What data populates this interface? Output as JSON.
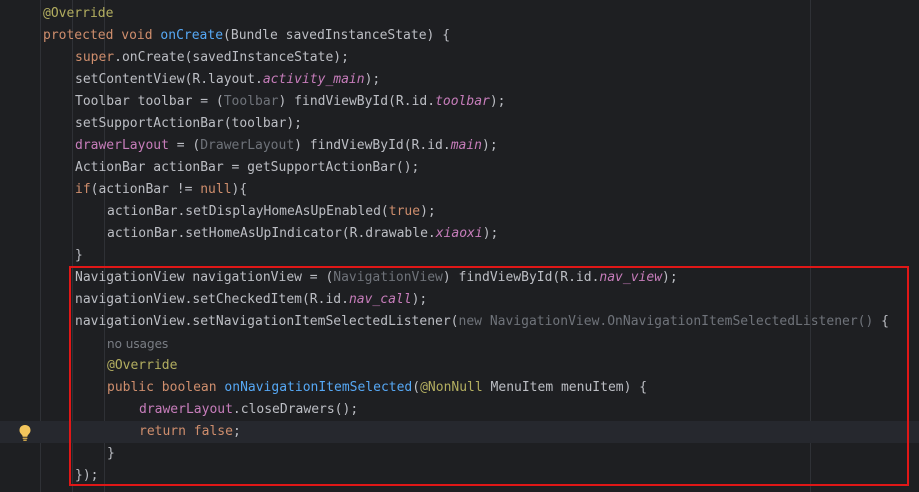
{
  "editor": {
    "lines": [
      {
        "indent": 0,
        "current": false,
        "tokens": [
          {
            "t": "@Override",
            "c": "ann"
          }
        ]
      },
      {
        "indent": 0,
        "current": false,
        "tokens": [
          {
            "t": "protected ",
            "c": "kw"
          },
          {
            "t": "void ",
            "c": "kw"
          },
          {
            "t": "onCreate",
            "c": "fn"
          },
          {
            "t": "(Bundle savedInstanceState) {",
            "c": ""
          }
        ]
      },
      {
        "indent": 1,
        "current": false,
        "tokens": [
          {
            "t": "super",
            "c": "kw"
          },
          {
            "t": ".onCreate(savedInstanceState);",
            "c": ""
          }
        ]
      },
      {
        "indent": 1,
        "current": false,
        "tokens": [
          {
            "t": "setContentView(R.layout.",
            "c": ""
          },
          {
            "t": "activity_main",
            "c": "fld"
          },
          {
            "t": ");",
            "c": ""
          }
        ]
      },
      {
        "indent": 1,
        "current": false,
        "tokens": [
          {
            "t": "Toolbar toolbar = (",
            "c": ""
          },
          {
            "t": "Toolbar",
            "c": "cast"
          },
          {
            "t": ") findViewById(R.id.",
            "c": ""
          },
          {
            "t": "toolbar",
            "c": "fld"
          },
          {
            "t": ");",
            "c": ""
          }
        ]
      },
      {
        "indent": 1,
        "current": false,
        "tokens": [
          {
            "t": "setSupportActionBar(toolbar);",
            "c": ""
          }
        ]
      },
      {
        "indent": 1,
        "current": false,
        "tokens": [
          {
            "t": "drawerLayout",
            "c": "fld-ni"
          },
          {
            "t": " = (",
            "c": ""
          },
          {
            "t": "DrawerLayout",
            "c": "cast"
          },
          {
            "t": ") findViewById(R.id.",
            "c": ""
          },
          {
            "t": "main",
            "c": "fld"
          },
          {
            "t": ");",
            "c": ""
          }
        ]
      },
      {
        "indent": 1,
        "current": false,
        "tokens": [
          {
            "t": "ActionBar actionBar = getSupportActionBar();",
            "c": ""
          }
        ]
      },
      {
        "indent": 1,
        "current": false,
        "tokens": [
          {
            "t": "if",
            "c": "kw"
          },
          {
            "t": "(actionBar != ",
            "c": ""
          },
          {
            "t": "null",
            "c": "kw"
          },
          {
            "t": "){",
            "c": ""
          }
        ]
      },
      {
        "indent": 2,
        "current": false,
        "tokens": [
          {
            "t": "actionBar.setDisplayHomeAsUpEnabled(",
            "c": ""
          },
          {
            "t": "true",
            "c": "kw"
          },
          {
            "t": ");",
            "c": ""
          }
        ]
      },
      {
        "indent": 2,
        "current": false,
        "tokens": [
          {
            "t": "actionBar.setHomeAsUpIndicator(R.drawable.",
            "c": ""
          },
          {
            "t": "xiaoxi",
            "c": "fld"
          },
          {
            "t": ");",
            "c": ""
          }
        ]
      },
      {
        "indent": 1,
        "current": false,
        "tokens": [
          {
            "t": "}",
            "c": ""
          }
        ]
      },
      {
        "indent": 1,
        "current": false,
        "tokens": [
          {
            "t": "NavigationView navigationView = (",
            "c": ""
          },
          {
            "t": "NavigationView",
            "c": "cast"
          },
          {
            "t": ") findViewById(R.id.",
            "c": ""
          },
          {
            "t": "nav_view",
            "c": "fld"
          },
          {
            "t": ");",
            "c": ""
          }
        ]
      },
      {
        "indent": 1,
        "current": false,
        "tokens": [
          {
            "t": "navigationView.setCheckedItem(R.id.",
            "c": ""
          },
          {
            "t": "nav_call",
            "c": "fld"
          },
          {
            "t": ");",
            "c": ""
          }
        ]
      },
      {
        "indent": 1,
        "current": false,
        "tokens": [
          {
            "t": "navigationView.setNavigationItemSelectedListener(",
            "c": ""
          },
          {
            "t": "new NavigationView.OnNavigationItemSelectedListener()",
            "c": "cast"
          },
          {
            "t": " {",
            "c": ""
          }
        ]
      },
      {
        "indent": 2,
        "current": false,
        "tokens": [
          {
            "t": "no usages",
            "c": "hint"
          }
        ]
      },
      {
        "indent": 2,
        "current": false,
        "tokens": [
          {
            "t": "@Override",
            "c": "ann"
          }
        ]
      },
      {
        "indent": 2,
        "current": false,
        "tokens": [
          {
            "t": "public ",
            "c": "kw"
          },
          {
            "t": "boolean ",
            "c": "kw"
          },
          {
            "t": "onNavigationItemSelected",
            "c": "fn"
          },
          {
            "t": "(",
            "c": ""
          },
          {
            "t": "@NonNull",
            "c": "ann"
          },
          {
            "t": " MenuItem menuItem) {",
            "c": ""
          }
        ]
      },
      {
        "indent": 3,
        "current": false,
        "tokens": [
          {
            "t": "drawerLayout",
            "c": "fld-ni"
          },
          {
            "t": ".closeDrawers();",
            "c": ""
          }
        ]
      },
      {
        "indent": 3,
        "current": true,
        "tokens": [
          {
            "t": "return ",
            "c": "kw"
          },
          {
            "t": "false",
            "c": "kw"
          },
          {
            "t": ";",
            "c": ""
          }
        ]
      },
      {
        "indent": 2,
        "current": false,
        "tokens": [
          {
            "t": "}",
            "c": ""
          }
        ]
      },
      {
        "indent": 1,
        "current": false,
        "tokens": [
          {
            "t": "});",
            "c": ""
          }
        ]
      }
    ]
  },
  "intention_bulb": {
    "icon": "lightbulb-icon",
    "color": "#f2c55c"
  },
  "highlight_box": {
    "color": "#e01717"
  }
}
